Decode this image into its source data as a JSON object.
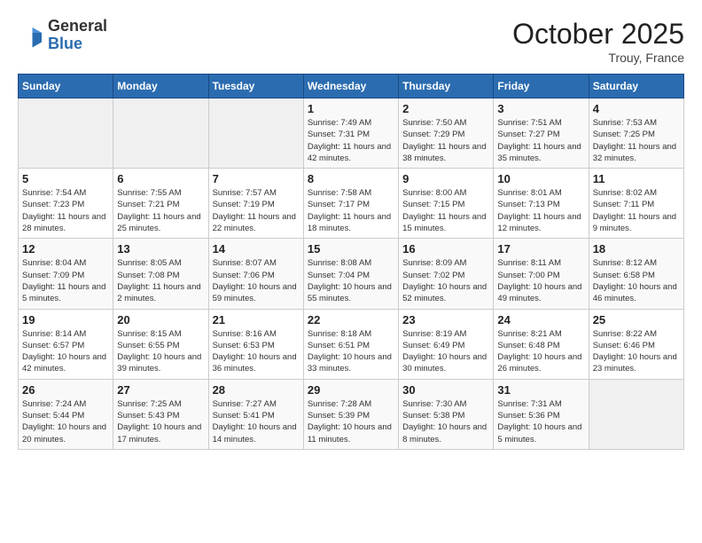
{
  "header": {
    "logo": {
      "general": "General",
      "blue": "Blue"
    },
    "title": "October 2025",
    "location": "Trouy, France"
  },
  "calendar": {
    "days_of_week": [
      "Sunday",
      "Monday",
      "Tuesday",
      "Wednesday",
      "Thursday",
      "Friday",
      "Saturday"
    ],
    "weeks": [
      [
        {
          "day": "",
          "info": ""
        },
        {
          "day": "",
          "info": ""
        },
        {
          "day": "",
          "info": ""
        },
        {
          "day": "1",
          "info": "Sunrise: 7:49 AM\nSunset: 7:31 PM\nDaylight: 11 hours and 42 minutes."
        },
        {
          "day": "2",
          "info": "Sunrise: 7:50 AM\nSunset: 7:29 PM\nDaylight: 11 hours and 38 minutes."
        },
        {
          "day": "3",
          "info": "Sunrise: 7:51 AM\nSunset: 7:27 PM\nDaylight: 11 hours and 35 minutes."
        },
        {
          "day": "4",
          "info": "Sunrise: 7:53 AM\nSunset: 7:25 PM\nDaylight: 11 hours and 32 minutes."
        }
      ],
      [
        {
          "day": "5",
          "info": "Sunrise: 7:54 AM\nSunset: 7:23 PM\nDaylight: 11 hours and 28 minutes."
        },
        {
          "day": "6",
          "info": "Sunrise: 7:55 AM\nSunset: 7:21 PM\nDaylight: 11 hours and 25 minutes."
        },
        {
          "day": "7",
          "info": "Sunrise: 7:57 AM\nSunset: 7:19 PM\nDaylight: 11 hours and 22 minutes."
        },
        {
          "day": "8",
          "info": "Sunrise: 7:58 AM\nSunset: 7:17 PM\nDaylight: 11 hours and 18 minutes."
        },
        {
          "day": "9",
          "info": "Sunrise: 8:00 AM\nSunset: 7:15 PM\nDaylight: 11 hours and 15 minutes."
        },
        {
          "day": "10",
          "info": "Sunrise: 8:01 AM\nSunset: 7:13 PM\nDaylight: 11 hours and 12 minutes."
        },
        {
          "day": "11",
          "info": "Sunrise: 8:02 AM\nSunset: 7:11 PM\nDaylight: 11 hours and 9 minutes."
        }
      ],
      [
        {
          "day": "12",
          "info": "Sunrise: 8:04 AM\nSunset: 7:09 PM\nDaylight: 11 hours and 5 minutes."
        },
        {
          "day": "13",
          "info": "Sunrise: 8:05 AM\nSunset: 7:08 PM\nDaylight: 11 hours and 2 minutes."
        },
        {
          "day": "14",
          "info": "Sunrise: 8:07 AM\nSunset: 7:06 PM\nDaylight: 10 hours and 59 minutes."
        },
        {
          "day": "15",
          "info": "Sunrise: 8:08 AM\nSunset: 7:04 PM\nDaylight: 10 hours and 55 minutes."
        },
        {
          "day": "16",
          "info": "Sunrise: 8:09 AM\nSunset: 7:02 PM\nDaylight: 10 hours and 52 minutes."
        },
        {
          "day": "17",
          "info": "Sunrise: 8:11 AM\nSunset: 7:00 PM\nDaylight: 10 hours and 49 minutes."
        },
        {
          "day": "18",
          "info": "Sunrise: 8:12 AM\nSunset: 6:58 PM\nDaylight: 10 hours and 46 minutes."
        }
      ],
      [
        {
          "day": "19",
          "info": "Sunrise: 8:14 AM\nSunset: 6:57 PM\nDaylight: 10 hours and 42 minutes."
        },
        {
          "day": "20",
          "info": "Sunrise: 8:15 AM\nSunset: 6:55 PM\nDaylight: 10 hours and 39 minutes."
        },
        {
          "day": "21",
          "info": "Sunrise: 8:16 AM\nSunset: 6:53 PM\nDaylight: 10 hours and 36 minutes."
        },
        {
          "day": "22",
          "info": "Sunrise: 8:18 AM\nSunset: 6:51 PM\nDaylight: 10 hours and 33 minutes."
        },
        {
          "day": "23",
          "info": "Sunrise: 8:19 AM\nSunset: 6:49 PM\nDaylight: 10 hours and 30 minutes."
        },
        {
          "day": "24",
          "info": "Sunrise: 8:21 AM\nSunset: 6:48 PM\nDaylight: 10 hours and 26 minutes."
        },
        {
          "day": "25",
          "info": "Sunrise: 8:22 AM\nSunset: 6:46 PM\nDaylight: 10 hours and 23 minutes."
        }
      ],
      [
        {
          "day": "26",
          "info": "Sunrise: 7:24 AM\nSunset: 5:44 PM\nDaylight: 10 hours and 20 minutes."
        },
        {
          "day": "27",
          "info": "Sunrise: 7:25 AM\nSunset: 5:43 PM\nDaylight: 10 hours and 17 minutes."
        },
        {
          "day": "28",
          "info": "Sunrise: 7:27 AM\nSunset: 5:41 PM\nDaylight: 10 hours and 14 minutes."
        },
        {
          "day": "29",
          "info": "Sunrise: 7:28 AM\nSunset: 5:39 PM\nDaylight: 10 hours and 11 minutes."
        },
        {
          "day": "30",
          "info": "Sunrise: 7:30 AM\nSunset: 5:38 PM\nDaylight: 10 hours and 8 minutes."
        },
        {
          "day": "31",
          "info": "Sunrise: 7:31 AM\nSunset: 5:36 PM\nDaylight: 10 hours and 5 minutes."
        },
        {
          "day": "",
          "info": ""
        }
      ]
    ]
  }
}
